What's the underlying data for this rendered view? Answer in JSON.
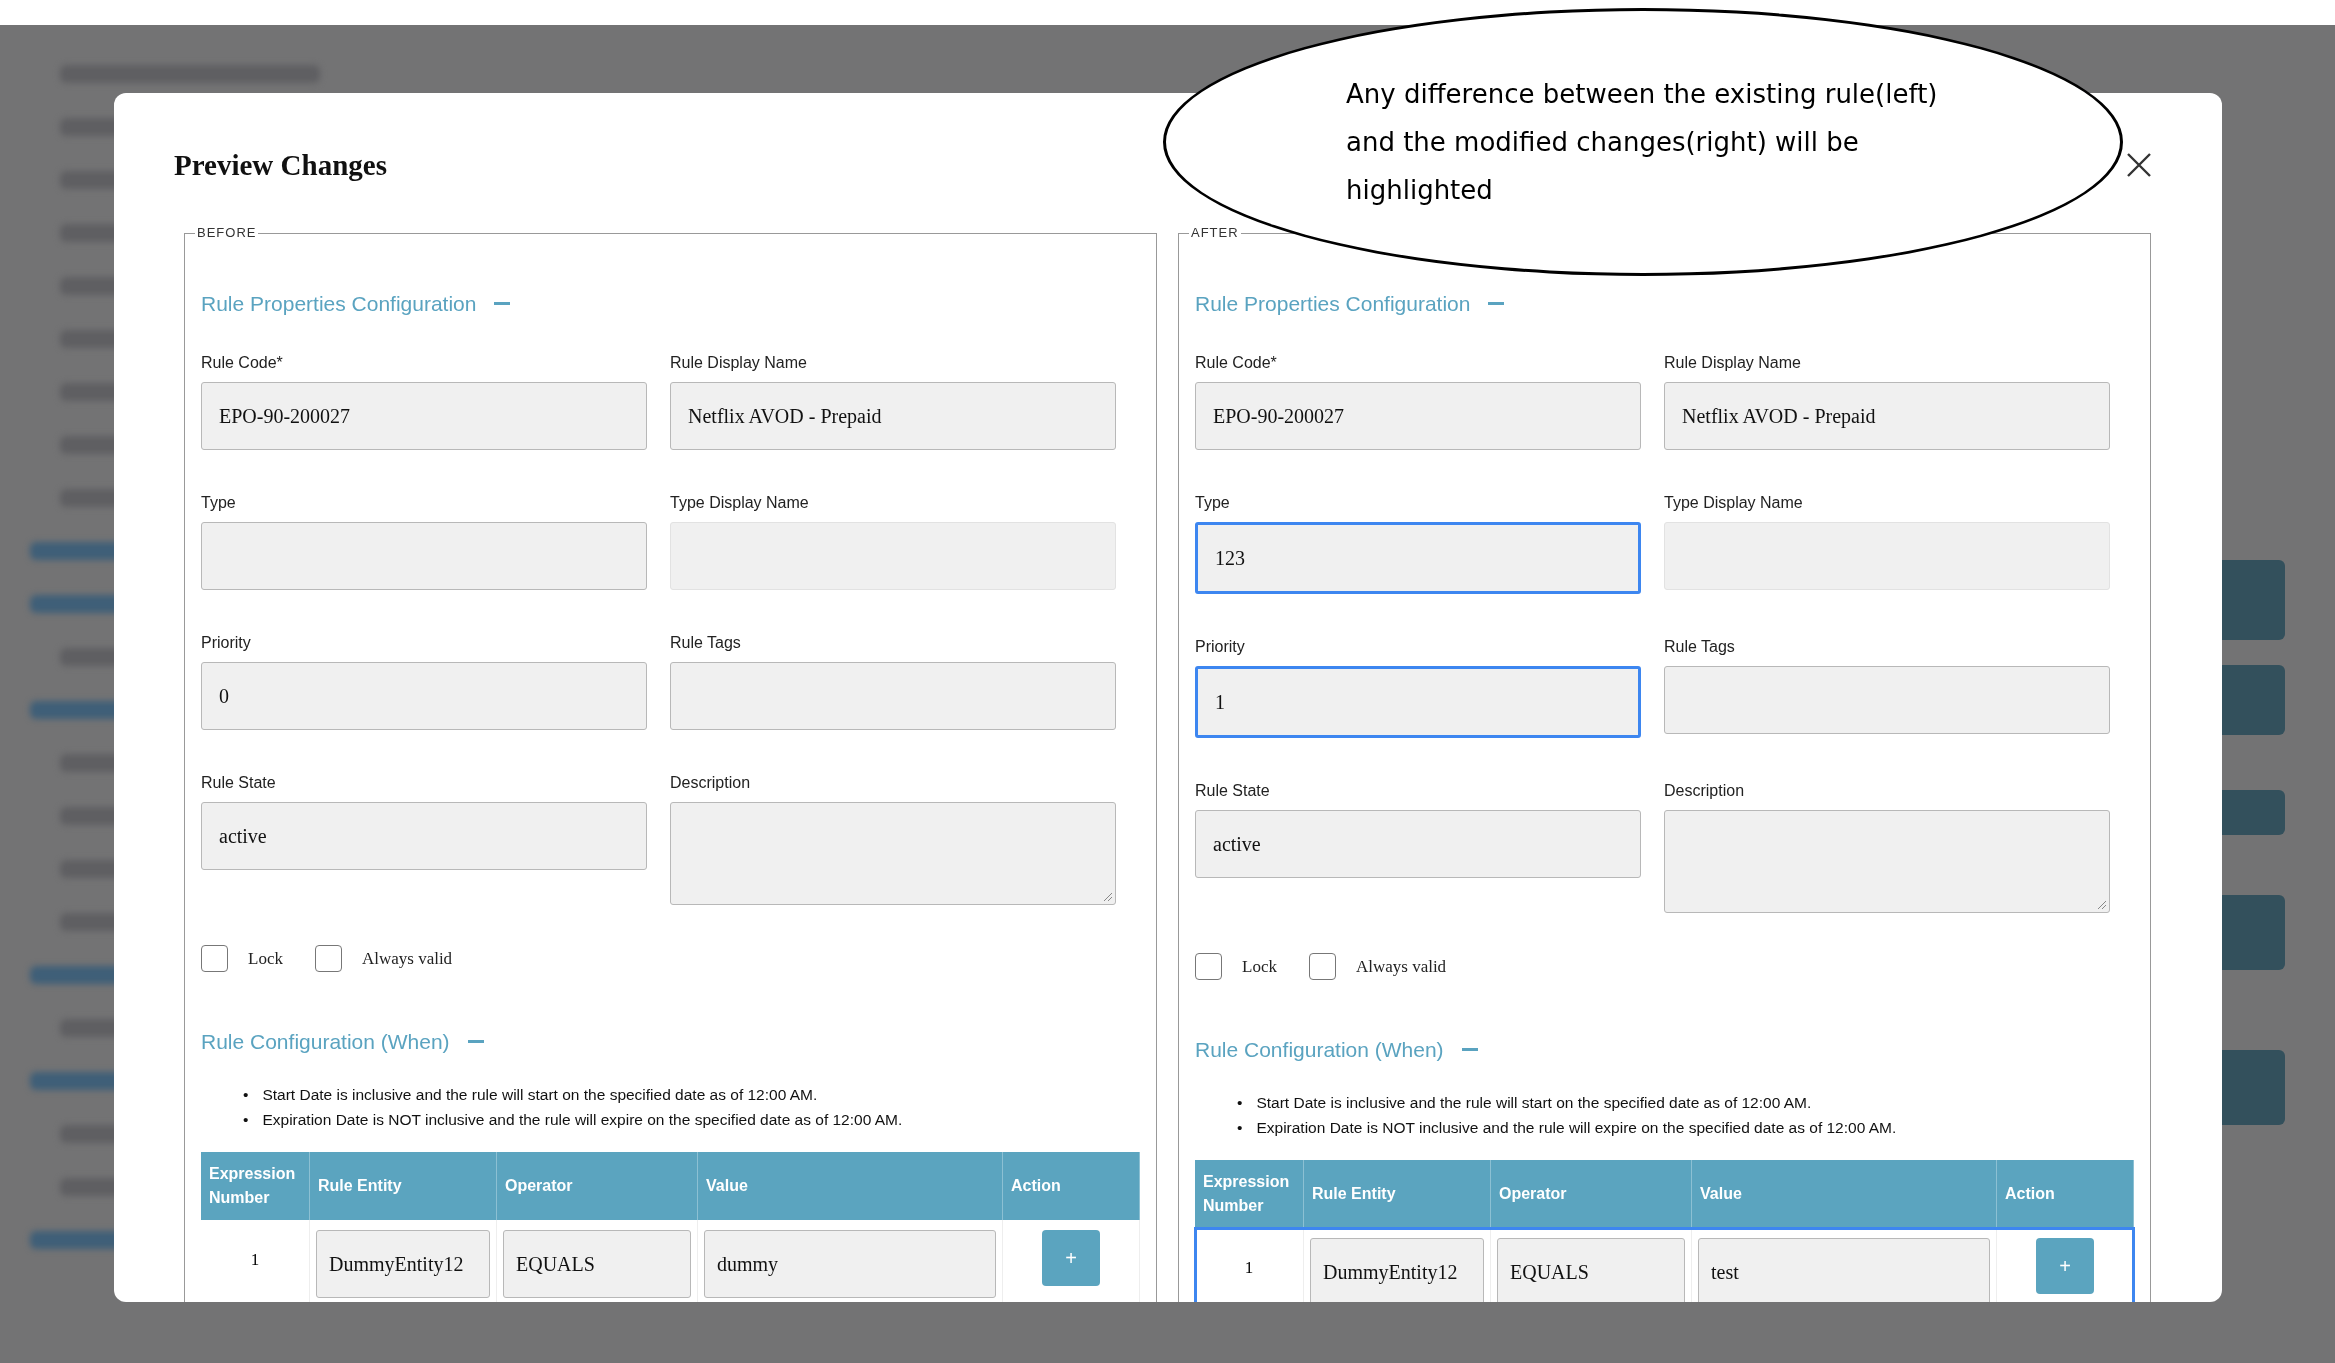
{
  "modal": {
    "title": "Preview Changes"
  },
  "panels": [
    {
      "legend": "BEFORE",
      "properties": {
        "title": "Rule Properties Configuration",
        "fields": [
          {
            "label": "Rule Code*",
            "value": "EPO-90-200027",
            "kind": "input",
            "disabled": false,
            "highlighted": false
          },
          {
            "label": "Rule Display Name",
            "value": "Netflix AVOD - Prepaid",
            "kind": "input",
            "disabled": false,
            "highlighted": false
          },
          {
            "label": "Type",
            "kind": "input",
            "disabled": false,
            "highlighted": false
          },
          {
            "label": "Type Display Name",
            "kind": "input",
            "disabled": true,
            "highlighted": false
          },
          {
            "label": "Priority",
            "value": "0",
            "kind": "input",
            "disabled": false,
            "highlighted": false
          },
          {
            "label": "Rule Tags",
            "kind": "input",
            "disabled": false,
            "highlighted": false
          },
          {
            "label": "Rule State",
            "value": "active",
            "kind": "input",
            "disabled": false,
            "highlighted": false
          },
          {
            "label": "Description",
            "kind": "textarea",
            "disabled": false,
            "highlighted": false
          }
        ]
      },
      "checkboxes": [
        {
          "label": "Lock",
          "checked": false
        },
        {
          "label": "Always valid",
          "checked": false
        }
      ],
      "conditions": {
        "title": "Rule Configuration (When)",
        "notes": [
          {
            "bullet": "•",
            "text": "Start Date is inclusive and the rule will start on the specified date as of 12:00 AM."
          },
          {
            "bullet": "•",
            "text": "Expiration Date is NOT inclusive and the rule will expire on the specified date as of 12:00 AM."
          }
        ],
        "columns": [
          "Expression Number",
          "Rule Entity",
          "Operator",
          "Value",
          "Action"
        ],
        "rows": [
          {
            "number": "1",
            "entity": "DummyEntity12",
            "operator": "EQUALS",
            "value": "dummy",
            "action": "+",
            "highlighted": false
          }
        ]
      }
    },
    {
      "legend": "AFTER",
      "properties": {
        "title": "Rule Properties Configuration",
        "fields": [
          {
            "label": "Rule Code*",
            "value": "EPO-90-200027",
            "kind": "input",
            "disabled": false,
            "highlighted": false
          },
          {
            "label": "Rule Display Name",
            "value": "Netflix AVOD - Prepaid",
            "kind": "input",
            "disabled": false,
            "highlighted": false
          },
          {
            "label": "Type",
            "value": "123",
            "kind": "input",
            "disabled": false,
            "highlighted": true
          },
          {
            "label": "Type Display Name",
            "kind": "input",
            "disabled": true,
            "highlighted": false
          },
          {
            "label": "Priority",
            "value": "1",
            "kind": "input",
            "disabled": false,
            "highlighted": true
          },
          {
            "label": "Rule Tags",
            "kind": "input",
            "disabled": false,
            "highlighted": false
          },
          {
            "label": "Rule State",
            "value": "active",
            "kind": "input",
            "disabled": false,
            "highlighted": false
          },
          {
            "label": "Description",
            "kind": "textarea",
            "disabled": false,
            "highlighted": false
          }
        ]
      },
      "checkboxes": [
        {
          "label": "Lock",
          "checked": false
        },
        {
          "label": "Always valid",
          "checked": false
        }
      ],
      "conditions": {
        "title": "Rule Configuration (When)",
        "notes": [
          {
            "bullet": "•",
            "text": "Start Date is inclusive and the rule will start on the specified date as of 12:00 AM."
          },
          {
            "bullet": "•",
            "text": "Expiration Date is NOT inclusive and the rule will expire on the specified date as of 12:00 AM."
          }
        ],
        "columns": [
          "Expression Number",
          "Rule Entity",
          "Operator",
          "Value",
          "Action"
        ],
        "rows": [
          {
            "number": "1",
            "entity": "DummyEntity12",
            "operator": "EQUALS",
            "value": "test",
            "action": "+",
            "highlighted": true
          }
        ]
      }
    }
  ],
  "callout": {
    "text": "Any difference between the existing rule(left) and the modified changes(right) will be highlighted"
  }
}
